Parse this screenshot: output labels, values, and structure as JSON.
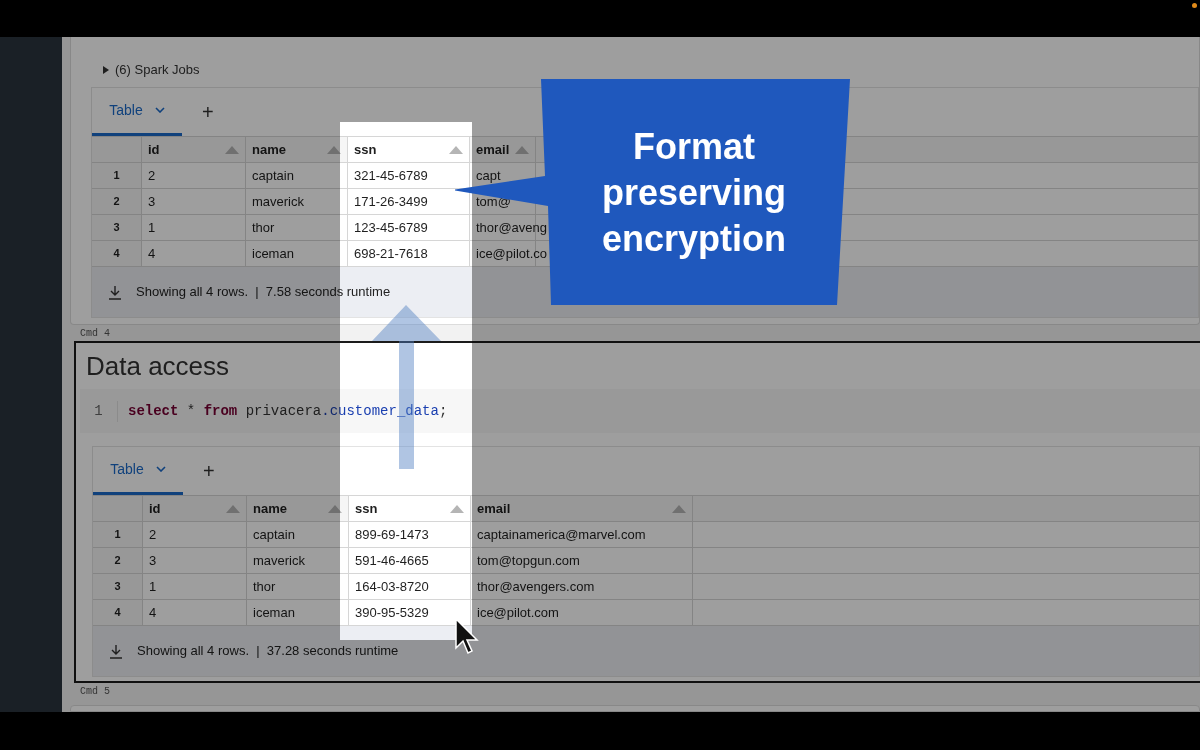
{
  "cells": [
    {
      "spark_jobs": "(6) Spark Jobs",
      "tabs": [
        {
          "label": "Table",
          "selected": true
        }
      ],
      "add_tab": "+",
      "table": {
        "columns": [
          "id",
          "name",
          "ssn",
          "email"
        ],
        "rows": [
          {
            "index": "1",
            "cells": [
              "2",
              "captain",
              "321-45-6789",
              "capt"
            ]
          },
          {
            "index": "2",
            "cells": [
              "3",
              "maverick",
              "171-26-3499",
              "tom@"
            ]
          },
          {
            "index": "3",
            "cells": [
              "1",
              "thor",
              "123-45-6789",
              "thor@aveng"
            ]
          },
          {
            "index": "4",
            "cells": [
              "4",
              "iceman",
              "698-21-7618",
              "ice@pilot.co"
            ]
          }
        ]
      },
      "footer": "Showing all 4 rows.  |  7.58 seconds runtime",
      "command_label": "Cmd 4",
      "active": false
    },
    {
      "title": "Data access",
      "code": {
        "line_number": "1",
        "tokens": [
          {
            "text": "select",
            "kind": "keyword"
          },
          {
            "text": " * ",
            "kind": "plain"
          },
          {
            "text": "from",
            "kind": "keyword"
          },
          {
            "text": " privacera",
            "kind": "plain"
          },
          {
            "text": ".customer_data",
            "kind": "name"
          },
          {
            "text": ";",
            "kind": "plain"
          }
        ]
      },
      "tabs": [
        {
          "label": "Table",
          "selected": true
        }
      ],
      "add_tab": "+",
      "table": {
        "columns": [
          "id",
          "name",
          "ssn",
          "email"
        ],
        "rows": [
          {
            "index": "1",
            "cells": [
              "2",
              "captain",
              "899-69-1473",
              "captainamerica@marvel.com"
            ]
          },
          {
            "index": "2",
            "cells": [
              "3",
              "maverick",
              "591-46-4665",
              "tom@topgun.com"
            ]
          },
          {
            "index": "3",
            "cells": [
              "1",
              "thor",
              "164-03-8720",
              "thor@avengers.com"
            ]
          },
          {
            "index": "4",
            "cells": [
              "4",
              "iceman",
              "390-95-5329",
              "ice@pilot.com"
            ]
          }
        ]
      },
      "footer": "Showing all 4 rows.  |  37.28 seconds runtime",
      "command_label": "Cmd 5",
      "active": true
    }
  ],
  "annotation": {
    "text": "Format preserving encryption"
  }
}
